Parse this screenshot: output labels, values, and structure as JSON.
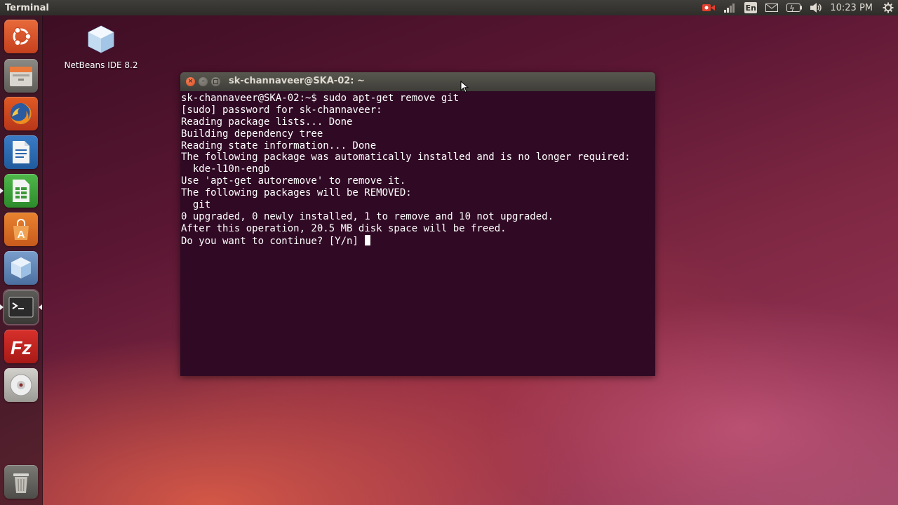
{
  "top_panel": {
    "app_title": "Terminal",
    "language": "En",
    "clock": "10:23 PM"
  },
  "launcher": {
    "items": [
      {
        "name": "Dash",
        "icon": "ubuntu-dash-icon"
      },
      {
        "name": "Files",
        "icon": "file-manager-icon"
      },
      {
        "name": "Firefox",
        "icon": "firefox-icon"
      },
      {
        "name": "LibreOffice Writer",
        "icon": "writer-icon"
      },
      {
        "name": "LibreOffice Calc",
        "icon": "calc-icon"
      },
      {
        "name": "Ubuntu Software Center",
        "icon": "software-center-icon"
      },
      {
        "name": "NetBeans IDE 8.2",
        "icon": "netbeans-icon"
      },
      {
        "name": "Terminal",
        "icon": "terminal-icon"
      },
      {
        "name": "FileZilla",
        "icon": "filezilla-icon"
      },
      {
        "name": "DVD",
        "icon": "disc-icon"
      },
      {
        "name": "Trash",
        "icon": "trash-icon"
      }
    ]
  },
  "desktop": {
    "icons": [
      {
        "label": "NetBeans IDE 8.2",
        "icon": "netbeans-icon"
      }
    ]
  },
  "terminal": {
    "title": "sk-channaveer@SKA-02: ~",
    "lines": [
      "sk-channaveer@SKA-02:~$ sudo apt-get remove git",
      "[sudo] password for sk-channaveer:",
      "Reading package lists... Done",
      "Building dependency tree",
      "Reading state information... Done",
      "The following package was automatically installed and is no longer required:",
      "  kde-l10n-engb",
      "Use 'apt-get autoremove' to remove it.",
      "The following packages will be REMOVED:",
      "  git",
      "0 upgraded, 0 newly installed, 1 to remove and 10 not upgraded.",
      "After this operation, 20.5 MB disk space will be freed.",
      "Do you want to continue? [Y/n] "
    ]
  },
  "colors": {
    "terminal_bg": "#300a24",
    "terminal_fg": "#ffffff",
    "close_button": "#e95420"
  }
}
